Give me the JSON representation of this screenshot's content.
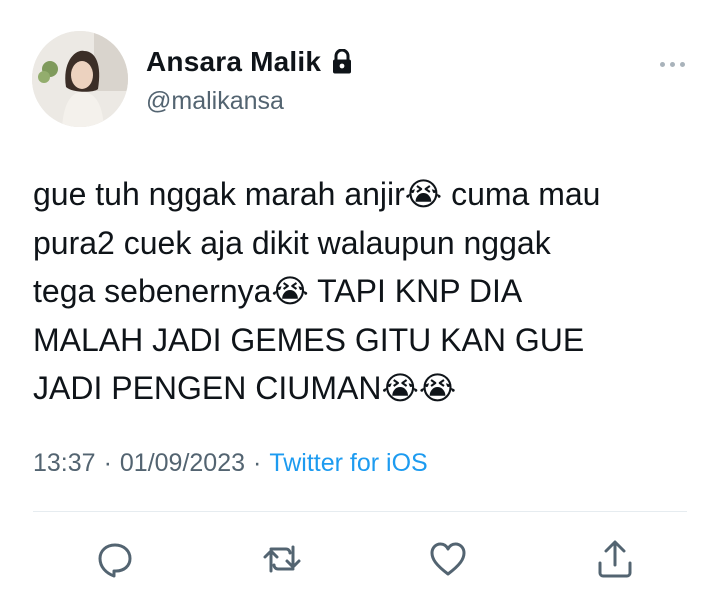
{
  "user": {
    "name": "Ansara Malik",
    "handle": "@malikansa",
    "protected_icon": "lock-icon"
  },
  "tweet": {
    "text": "gue tuh nggak marah anjir😭 cuma mau\npura2 cuek aja dikit walaupun nggak\ntega sebenernya😭 TAPI KNP DIA\nMALAH JADI GEMES GITU KAN GUE\nJADI PENGEN CIUMAN😭😭"
  },
  "meta": {
    "time": "13:37",
    "sep1": "·",
    "date": "01/09/2023",
    "sep2": "·",
    "source": "Twitter for iOS"
  },
  "actions": [
    "reply-icon",
    "retweet-icon",
    "like-icon",
    "share-icon"
  ],
  "colors": {
    "text": "#0f1419",
    "secondary": "#536471",
    "link": "#1d9bf0",
    "icon": "#536471"
  }
}
